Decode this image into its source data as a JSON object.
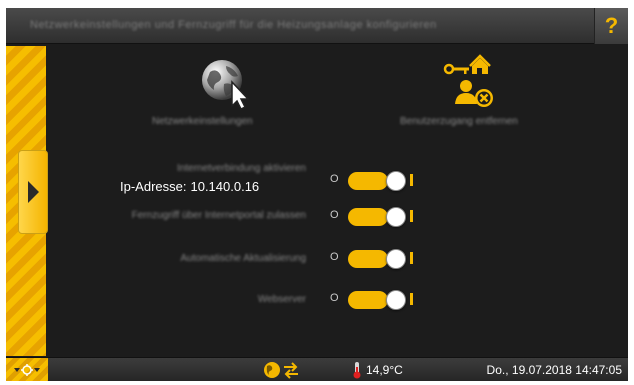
{
  "title": "Netzwerkeinstellungen und Fernzugriff für die Heizungsanlage konfigurieren",
  "help_label": "?",
  "remote": {
    "label": "Netzwerkeinstellungen"
  },
  "user": {
    "label": "Benutzerzugang entfernen"
  },
  "settings": {
    "row1_label": "Internetverbindung aktivieren",
    "ip_prefix": "Ip-Adresse:",
    "ip_value": "10.140.0.16",
    "row2_label": "Fernzugriff über Internetportal zulassen",
    "row3_label": "Automatische Aktualisierung",
    "row4_label": "Webserver"
  },
  "toggle": {
    "off_label": "O",
    "states": [
      true,
      true,
      true,
      true
    ]
  },
  "status": {
    "temperature": "14,9°C",
    "datetime": "Do., 19.07.2018 14:47:05"
  },
  "colors": {
    "accent": "#f5b800",
    "background": "#1c1c1c",
    "titlebar": "#3b3b3b"
  },
  "icons": {
    "help": "question-mark-icon",
    "menu_toggle": "chevron-right-icon",
    "remote": "globe-cursor-icon",
    "user": "user-key-home-icon",
    "status_menu": "hazard-menu-icon",
    "status_network": "globe-transfer-icon",
    "status_temp": "thermometer-icon"
  }
}
